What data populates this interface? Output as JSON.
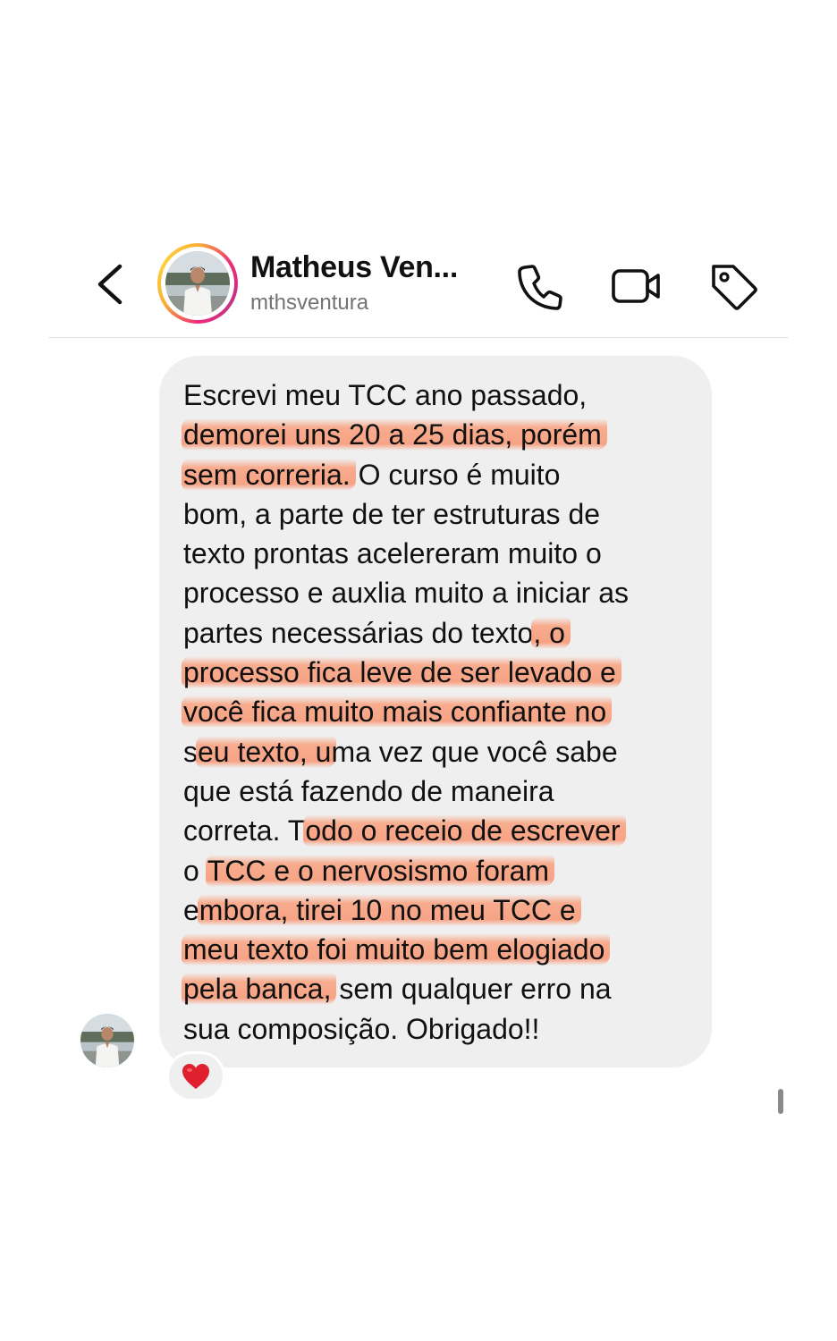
{
  "header": {
    "display_name": "Matheus Ven...",
    "username": "mthsventura",
    "icons": {
      "back": "chevron-left-icon",
      "call": "phone-icon",
      "video": "video-camera-icon",
      "tag": "tag-icon"
    },
    "ring_colors": [
      "#f9b233",
      "#ee2a7b",
      "#c13584"
    ]
  },
  "message": {
    "lines": [
      [
        {
          "t": "Escrevi meu TCC ano passado,",
          "h": false
        }
      ],
      [
        {
          "t": "demorei uns 20 a 25 dias, porém",
          "h": true
        }
      ],
      [
        {
          "t": "sem correria.",
          "h": true
        },
        {
          "t": " O curso é muito",
          "h": false
        }
      ],
      [
        {
          "t": "bom, a parte de ter estruturas de",
          "h": false
        }
      ],
      [
        {
          "t": "texto prontas acelereram muito o",
          "h": false
        }
      ],
      [
        {
          "t": "processo e auxlia muito a iniciar as",
          "h": false
        }
      ],
      [
        {
          "t": "partes necessárias do texto",
          "h": false
        },
        {
          "t": ", o",
          "h": true
        }
      ],
      [
        {
          "t": "processo fica leve de ser levado e",
          "h": true
        }
      ],
      [
        {
          "t": "você fica muito mais confiante no",
          "h": true
        }
      ],
      [
        {
          "t": "s",
          "h": false
        },
        {
          "t": "eu texto, u",
          "h": true
        },
        {
          "t": "ma vez que você sabe",
          "h": false
        }
      ],
      [
        {
          "t": "que está fazendo de maneira",
          "h": false
        }
      ],
      [
        {
          "t": "correta. T",
          "h": false
        },
        {
          "t": "odo o receio de escrever",
          "h": true
        }
      ],
      [
        {
          "t": "o ",
          "h": false
        },
        {
          "t": "TCC e o nervosismo foram",
          "h": true
        }
      ],
      [
        {
          "t": "e",
          "h": false
        },
        {
          "t": "mbora, tirei 10 no meu TCC e",
          "h": true
        }
      ],
      [
        {
          "t": "meu texto foi muito bem elogiado",
          "h": true
        }
      ],
      [
        {
          "t": "pela banca,",
          "h": true
        },
        {
          "t": " sem qualquer erro na",
          "h": false
        }
      ],
      [
        {
          "t": "sua composição. Obrigado!!",
          "h": false
        }
      ]
    ],
    "highlight_color": "#f8a07d",
    "bubble_color": "#efefef"
  },
  "reaction": {
    "icon": "heart-icon",
    "color": "#e0202e"
  }
}
